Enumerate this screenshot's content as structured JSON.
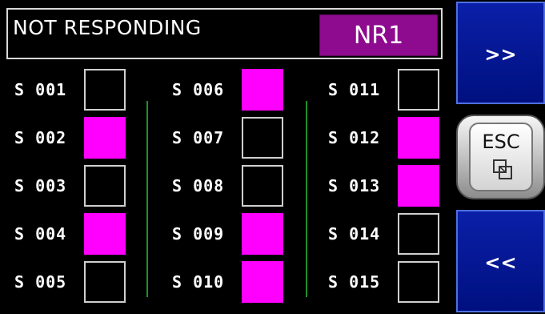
{
  "header": {
    "title": "NOT RESPONDING",
    "code": "NR1"
  },
  "colors": {
    "active": "#ff00ff",
    "inactive": "#000000",
    "code_badge": "#8e0a8e",
    "nav_button": "#0a1fa8",
    "divider": "#1f8f2c"
  },
  "stations": [
    {
      "label": "S 001",
      "active": false
    },
    {
      "label": "S 002",
      "active": true
    },
    {
      "label": "S 003",
      "active": false
    },
    {
      "label": "S 004",
      "active": true
    },
    {
      "label": "S 005",
      "active": false
    },
    {
      "label": "S 006",
      "active": true
    },
    {
      "label": "S 007",
      "active": false
    },
    {
      "label": "S 008",
      "active": false
    },
    {
      "label": "S 009",
      "active": true
    },
    {
      "label": "S 010",
      "active": true
    },
    {
      "label": "S 011",
      "active": false
    },
    {
      "label": "S 012",
      "active": true
    },
    {
      "label": "S 013",
      "active": true
    },
    {
      "label": "S 014",
      "active": false
    },
    {
      "label": "S 015",
      "active": false
    }
  ],
  "nav": {
    "next_label": ">>",
    "esc_label": "ESC",
    "esc_icon": "window-layers-icon",
    "prev_label": "<<"
  }
}
